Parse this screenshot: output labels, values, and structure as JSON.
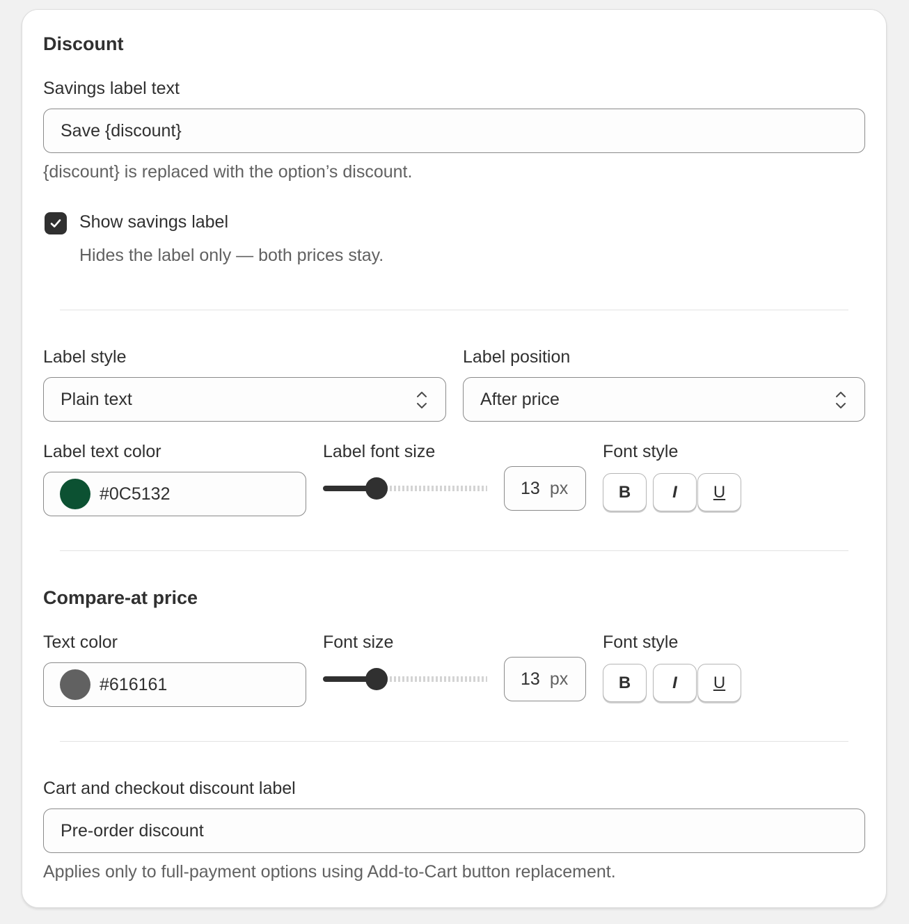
{
  "discount": {
    "heading": "Discount",
    "savings_label": "Savings label text",
    "savings_value": "Save {discount}",
    "savings_help": "{discount} is replaced with the option’s discount.",
    "show_savings": {
      "label": "Show savings label",
      "checked": true,
      "help": "Hides the label only — both prices stay."
    },
    "label_style": {
      "label": "Label style",
      "value": "Plain text"
    },
    "label_position": {
      "label": "Label position",
      "value": "After price"
    },
    "label_text_color": {
      "label": "Label text color",
      "value": "#0C5132",
      "swatch": "#0c5132"
    },
    "label_font_size": {
      "label": "Label font size",
      "value": "13",
      "unit": "px"
    },
    "font_style": {
      "label": "Font style",
      "bold": "B",
      "italic": "I",
      "underline": "U"
    }
  },
  "compare": {
    "heading": "Compare-at price",
    "text_color": {
      "label": "Text color",
      "value": "#616161",
      "swatch": "#616161"
    },
    "font_size": {
      "label": "Font size",
      "value": "13",
      "unit": "px"
    },
    "font_style": {
      "label": "Font style",
      "bold": "B",
      "italic": "I",
      "underline": "U"
    }
  },
  "cart": {
    "label": "Cart and checkout discount label",
    "value": "Pre-order discount",
    "help": "Applies only to full-payment options using Add-to-Cart button replacement."
  }
}
